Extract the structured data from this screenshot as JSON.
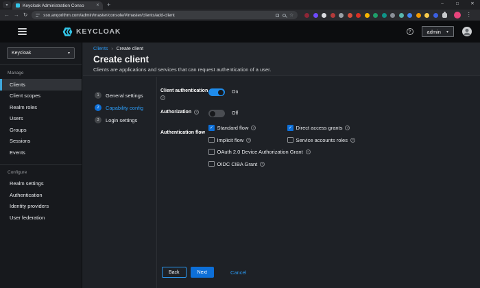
{
  "browser": {
    "tab_title": "Keycloak Administration Conso",
    "url": "sso.anqorithm.com/admin/master/console/#/master/clients/add-client",
    "extensions": [
      "#8d2637",
      "#6d4aff",
      "#dadce0",
      "#b33a3a",
      "#9aa0a6",
      "#d94f3d",
      "#d93025",
      "#f4b400",
      "#1e9e6a",
      "#0e9488",
      "#8a8f98",
      "#58b7ae",
      "#4285f4",
      "#f29900",
      "#f7cb4d",
      "#3b5fe0"
    ]
  },
  "icons": {
    "close": "✕",
    "minimize": "–",
    "maximize": "□",
    "plus": "+",
    "back": "←",
    "forward": "→",
    "reload": "↻",
    "star": "☆",
    "caret": "▾",
    "breadcrumb_sep": "›",
    "help": "?",
    "kebab": "⋮",
    "check": "✓"
  },
  "masthead": {
    "brand": "KEYCLOAK",
    "user": "admin"
  },
  "sidebar": {
    "realm": "Keycloak",
    "sections": [
      {
        "label": "Manage",
        "items": [
          {
            "label": "Clients",
            "active": true
          },
          {
            "label": "Client scopes"
          },
          {
            "label": "Realm roles"
          },
          {
            "label": "Users"
          },
          {
            "label": "Groups"
          },
          {
            "label": "Sessions"
          },
          {
            "label": "Events"
          }
        ]
      },
      {
        "label": "Configure",
        "items": [
          {
            "label": "Realm settings"
          },
          {
            "label": "Authentication"
          },
          {
            "label": "Identity providers"
          },
          {
            "label": "User federation"
          }
        ]
      }
    ]
  },
  "breadcrumb": {
    "parent": "Clients",
    "current": "Create client"
  },
  "page": {
    "title": "Create client",
    "subtitle": "Clients are applications and services that can request authentication of a user."
  },
  "wizard": {
    "steps": [
      {
        "num": "1",
        "label": "General settings",
        "active": false
      },
      {
        "num": "2",
        "label": "Capability config",
        "active": true
      },
      {
        "num": "3",
        "label": "Login settings",
        "active": false
      }
    ]
  },
  "form": {
    "client_auth": {
      "label": "Client authentication",
      "on": true,
      "state": "On"
    },
    "authorization": {
      "label": "Authorization",
      "on": false,
      "state": "Off"
    },
    "auth_flow": {
      "label": "Authentication flow",
      "options": [
        {
          "label": "Standard flow",
          "checked": true
        },
        {
          "label": "Direct access grants",
          "checked": true
        },
        {
          "label": "Implicit flow",
          "checked": false
        },
        {
          "label": "Service accounts roles",
          "checked": false
        },
        {
          "label": "OAuth 2.0 Device Authorization Grant",
          "checked": false
        },
        {
          "label": "OIDC CIBA Grant",
          "checked": false
        }
      ]
    }
  },
  "footer": {
    "back": "Back",
    "next": "Next",
    "cancel": "Cancel"
  },
  "colors": {
    "primary": "#0d6fd8",
    "link": "#2b9af3",
    "toggle_on": "#1f8ceb",
    "active_nav": "#3fa7dc",
    "logo_cyan": "#33c6e9"
  }
}
